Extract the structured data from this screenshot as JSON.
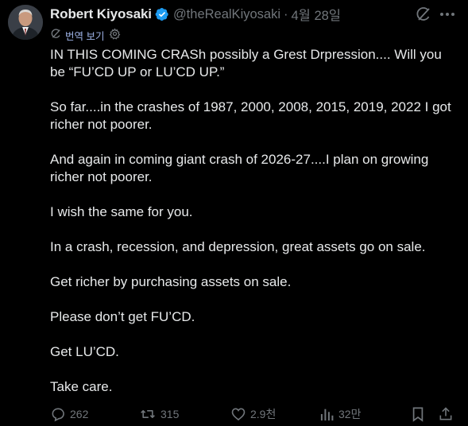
{
  "author": {
    "display_name": "Robert Kiyosaki",
    "handle": "@theRealKiyosaki",
    "separator": "·",
    "date": "4월 28일",
    "verified": true,
    "verified_color": "#1d9bf0"
  },
  "translate": {
    "label": "번역 보기"
  },
  "header_icons": [
    "grok-icon",
    "more-icon"
  ],
  "tweet": {
    "paragraphs": [
      "IN THIS COMING CRASh possibly a Grest Drpression.... Will you be “FU’CD UP or LU’CD UP.”",
      "So far....in the crashes of 1987, 2000, 2008, 2015, 2019, 2022 I got richer not poorer.",
      "And again in coming giant crash of 2026-27....I plan on growing richer not poorer.",
      "I wish the same for you.",
      "In a crash, recession, and depression, great assets go on sale.",
      "Get richer by purchasing assets on sale.",
      "Please don’t get FU’CD.",
      "Get LU’CD.",
      "Take care."
    ]
  },
  "actions": {
    "replies": "262",
    "reposts": "315",
    "likes": "2.9천",
    "views": "32만"
  },
  "colors": {
    "background": "#000000",
    "text": "#e7e9ea",
    "muted": "#71767b",
    "link": "#9fb4e8"
  }
}
